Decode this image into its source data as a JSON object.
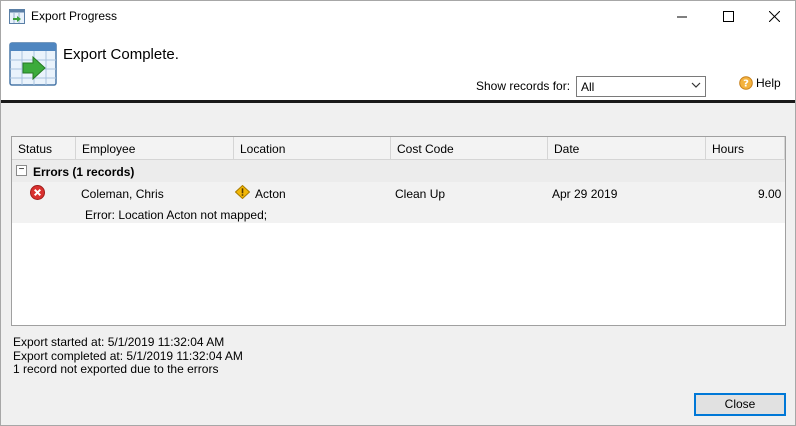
{
  "window": {
    "title": "Export Progress"
  },
  "header": {
    "title": "Export Complete.",
    "show_records_label": "Show records for:",
    "show_records_value": "All",
    "help_label": "Help"
  },
  "grid": {
    "columns": [
      "Status",
      "Employee",
      "Location",
      "Cost Code",
      "Date",
      "Hours"
    ],
    "group": {
      "expander": "−",
      "label": "Errors  (1 records)"
    },
    "rows": [
      {
        "status": "error",
        "employee": "Coleman, Chris",
        "location": "Acton",
        "location_status": "warning",
        "cost_code": "Clean Up",
        "date": "Apr 29 2019",
        "hours": "9.00",
        "message": "Error: Location Acton not mapped;"
      }
    ]
  },
  "status": {
    "started": "Export started at: 5/1/2019 11:32:04 AM",
    "completed": "Export completed at: 5/1/2019 11:32:04 AM",
    "summary": "1 record not exported due to the errors"
  },
  "buttons": {
    "close": "Close"
  },
  "colors": {
    "accent": "#0078d7",
    "error": "#d9312f",
    "warning": "#f2b705"
  }
}
